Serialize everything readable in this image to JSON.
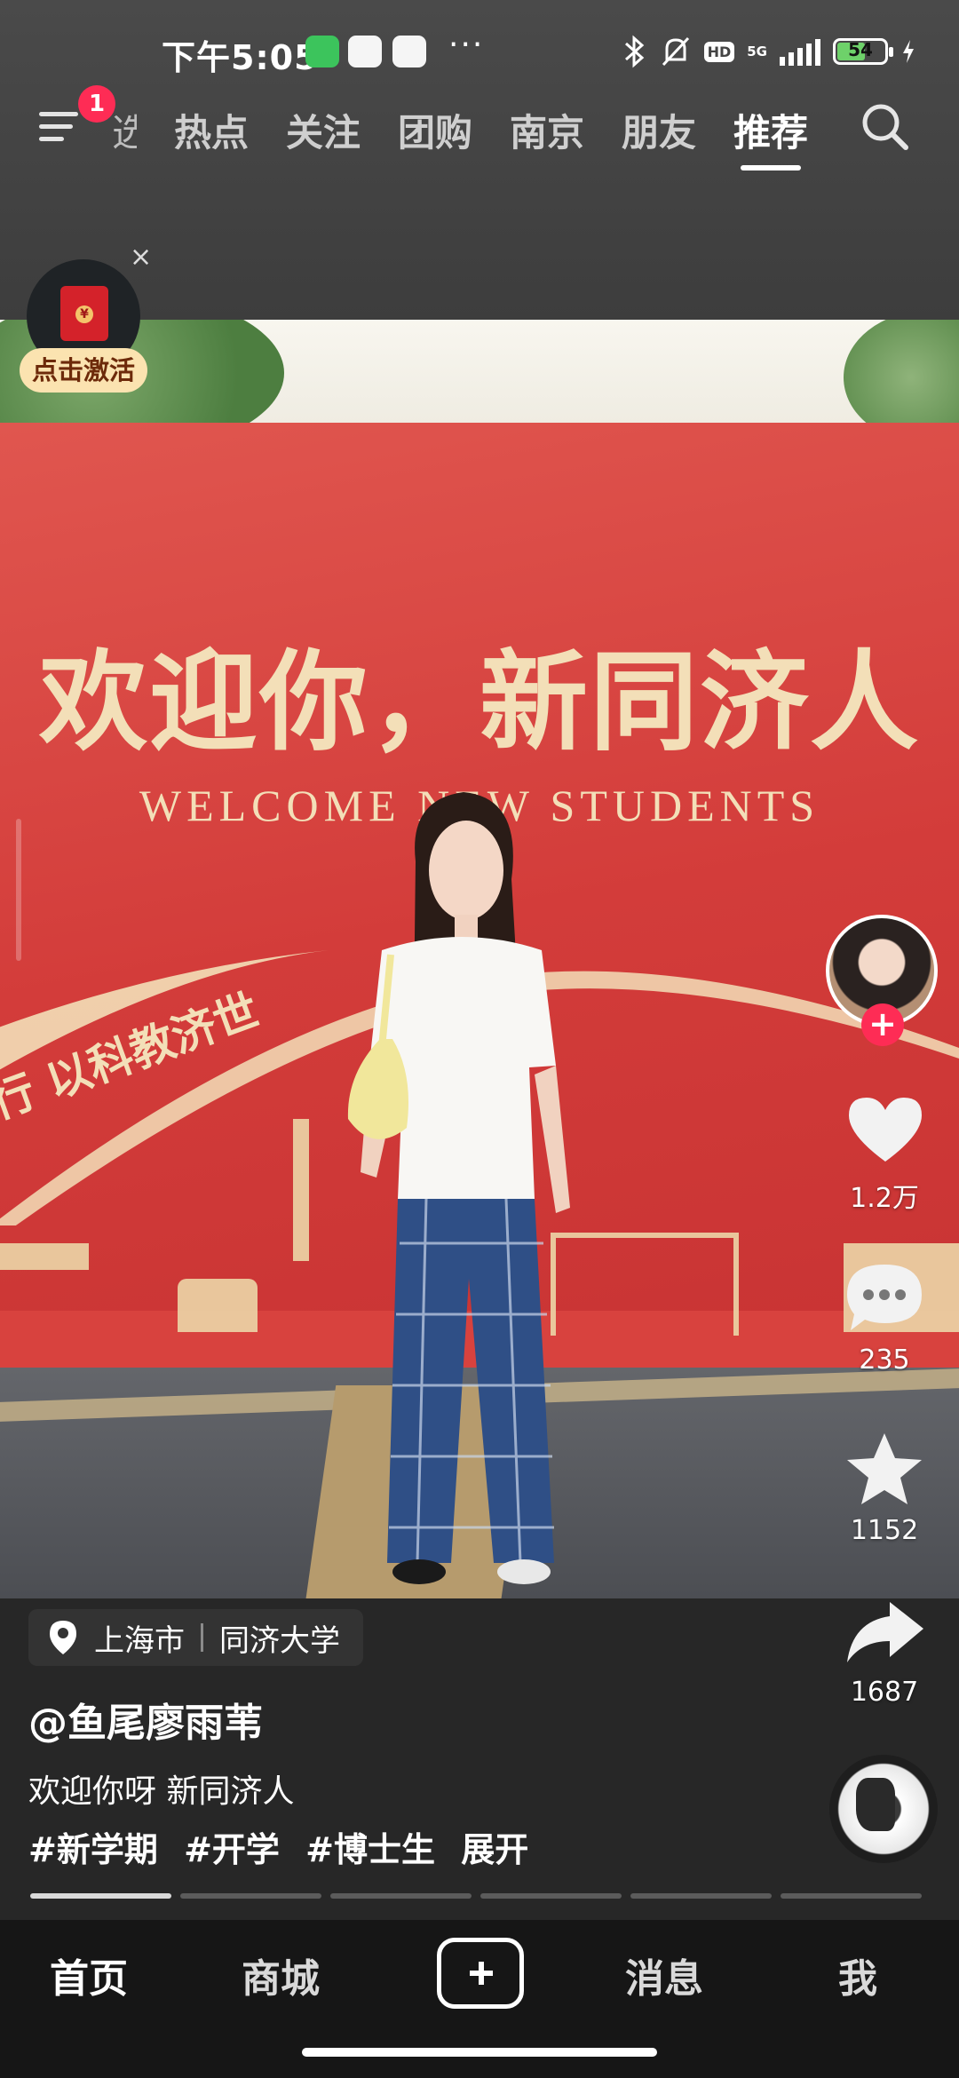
{
  "status_bar": {
    "time": "下午5:05",
    "app_icons": [
      "wechat-cat-icon",
      "58-app-icon",
      "baidu-netdisk-icon"
    ],
    "more": "···",
    "hd": "HD",
    "network": "5G",
    "battery": "54",
    "colors": {
      "battery_fill": "#6ed16a"
    }
  },
  "nav": {
    "menu_badge": "1",
    "partial_tab": "选",
    "tabs": [
      "热点",
      "关注",
      "团购",
      "南京",
      "朋友",
      "推荐"
    ],
    "active_tab": "推荐"
  },
  "red_packet": {
    "label": "点击激活",
    "close": "×"
  },
  "video": {
    "banner_title": "欢迎你，新同济人",
    "banner_subtitle": "WELCOME NEW STUDENTS",
    "banner_motto": "行 以科教济世"
  },
  "actions": {
    "like_count": "1.2万",
    "comment_count": "235",
    "favorite_count": "1152",
    "share_count": "1687"
  },
  "info": {
    "location_city": "上海市",
    "location_place": "同济大学",
    "author": "@鱼尾廖雨苇",
    "description": "欢迎你呀 新同济人",
    "tags": [
      "#新学期",
      "#开学",
      "#博士生"
    ],
    "expand": "展开",
    "progress_segments": 6,
    "progress_active": 1
  },
  "tabbar": {
    "home": "首页",
    "mall": "商城",
    "messages": "消息",
    "me": "我"
  },
  "colors": {
    "accent": "#fe2c55",
    "banner_red": "#d8423e",
    "banner_gold": "#f3dfb8"
  }
}
